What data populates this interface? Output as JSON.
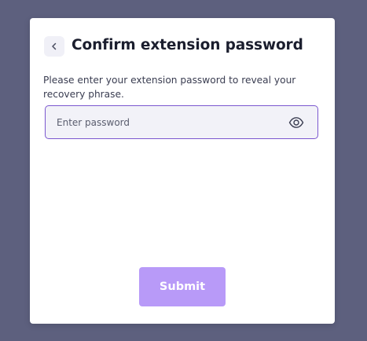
{
  "dialog": {
    "title": "Confirm extension password",
    "description": "Please enter your extension password to reveal your recovery phrase."
  },
  "password_field": {
    "placeholder": "Enter password",
    "value": ""
  },
  "actions": {
    "submit_label": "Submit"
  },
  "icons": {
    "back": "chevron-left-icon",
    "reveal": "eye-icon"
  },
  "colors": {
    "backdrop": "#5d607e",
    "card": "#ffffff",
    "title": "#1b1e2e",
    "input_border": "#7b57cf",
    "input_bg": "#f2f2f8",
    "submit_bg": "#b89af8"
  }
}
